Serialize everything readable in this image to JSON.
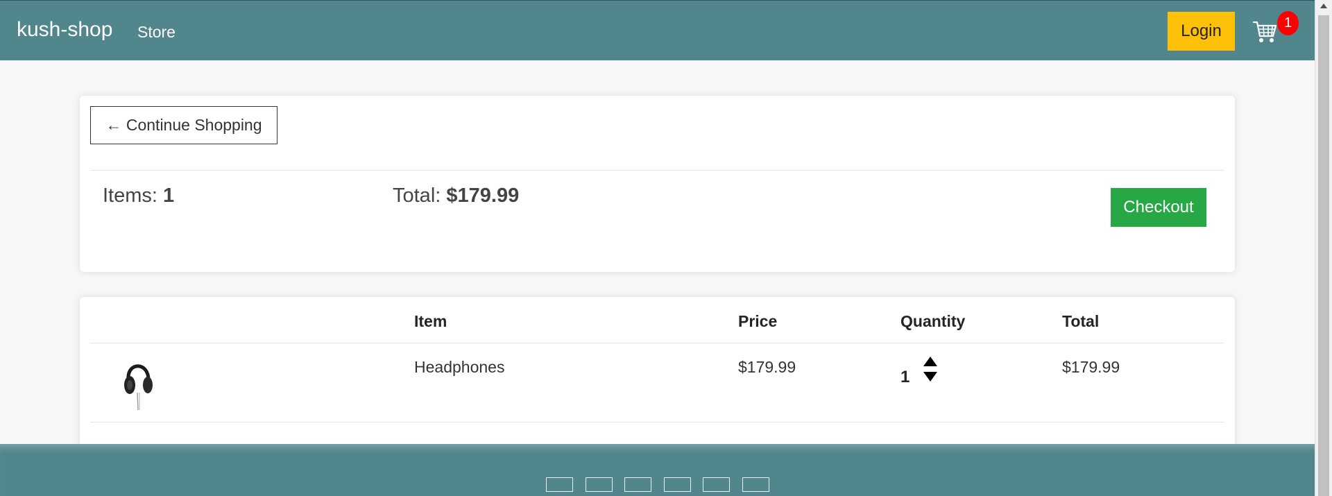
{
  "header": {
    "brand": "kush-shop",
    "nav_store": "Store",
    "login_label": "Login",
    "cart_count": "1"
  },
  "summary": {
    "continue_label": "← Continue Shopping",
    "items_label": "Items: ",
    "items_value": "1",
    "total_label": "Total: ",
    "total_value": "$179.99",
    "checkout_label": "Checkout"
  },
  "cart_table": {
    "headers": {
      "item": "Item",
      "price": "Price",
      "quantity": "Quantity",
      "total": "Total"
    },
    "rows": [
      {
        "image": "headphones-image",
        "name": "Headphones",
        "price": "$179.99",
        "quantity": "1",
        "total": "$179.99"
      }
    ]
  },
  "footer": {
    "links": [
      "footer-link-1",
      "footer-link-2",
      "footer-link-3",
      "footer-link-4",
      "footer-link-5",
      "footer-link-6"
    ]
  },
  "colors": {
    "navbar": "#51868c",
    "login": "#fec107",
    "checkout": "#28a745",
    "badge": "#ff0000"
  }
}
